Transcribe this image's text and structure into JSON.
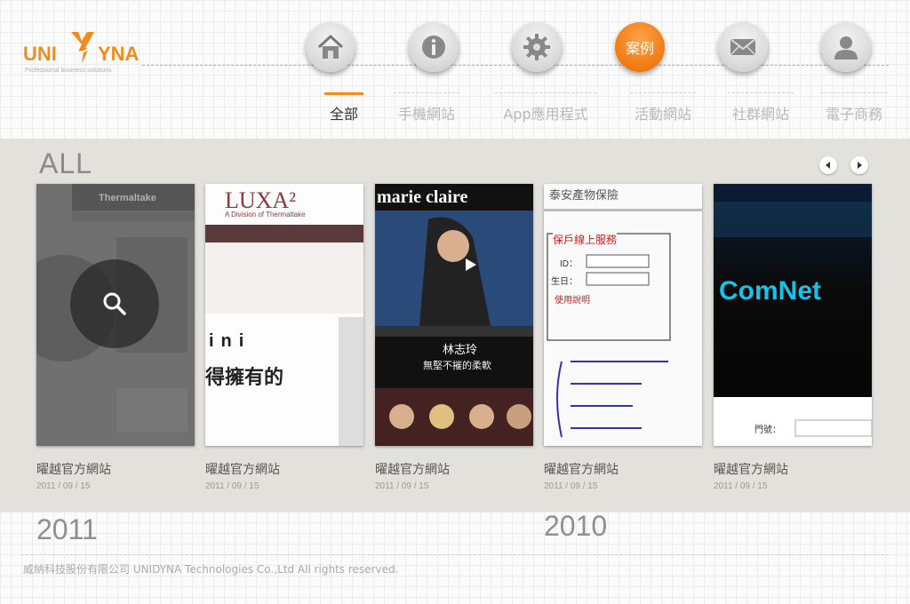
{
  "brand": {
    "logo_left": "UNI",
    "logo_right": "YNA",
    "tagline": "Professional business solutions",
    "accent": "#f08c1e"
  },
  "nav": {
    "items": [
      {
        "icon": "home-icon"
      },
      {
        "icon": "info-icon"
      },
      {
        "icon": "gear-icon"
      },
      {
        "label": "案例",
        "active": true
      },
      {
        "icon": "mail-icon"
      },
      {
        "icon": "user-icon"
      }
    ]
  },
  "tabs": [
    {
      "label": "全部",
      "active": true
    },
    {
      "label": "手機網站"
    },
    {
      "label": "App應用程式"
    },
    {
      "label": "活動網站"
    },
    {
      "label": "社群網站"
    },
    {
      "label": "電子商務"
    }
  ],
  "section": {
    "title": "ALL"
  },
  "cards": [
    {
      "title": "曜越官方網站",
      "date": "2011 / 09 / 15",
      "brand_text": "Thermaltake"
    },
    {
      "title": "曜越官方網站",
      "date": "2011 / 09 / 15",
      "brand_text": "LUXA²",
      "sub_text": "A Division of Thermaltake",
      "body_text": "ini",
      "body_text2": "得擁有的"
    },
    {
      "title": "曜越官方網站",
      "date": "2011 / 09 / 15",
      "brand_text": "marie claire",
      "name_text": "林志玲",
      "quote_text": "無堅不摧的柔軟"
    },
    {
      "title": "曜越官方網站",
      "date": "2011 / 09 / 15",
      "brand_text": "泰安產物保險",
      "heading_text": "保戶線上服務",
      "id_label": "ID：",
      "birth_label": "生日：",
      "link_text": "使用說明"
    },
    {
      "title": "曜越官方網站",
      "date": "2011 / 09 / 15",
      "brand_text": "ComNet",
      "field_label": "門號："
    }
  ],
  "years": [
    "2011",
    "2010"
  ],
  "footer": {
    "text": "威納科技股份有限公司 UNIDYNA Technologies Co.,Ltd All rights reserved."
  }
}
